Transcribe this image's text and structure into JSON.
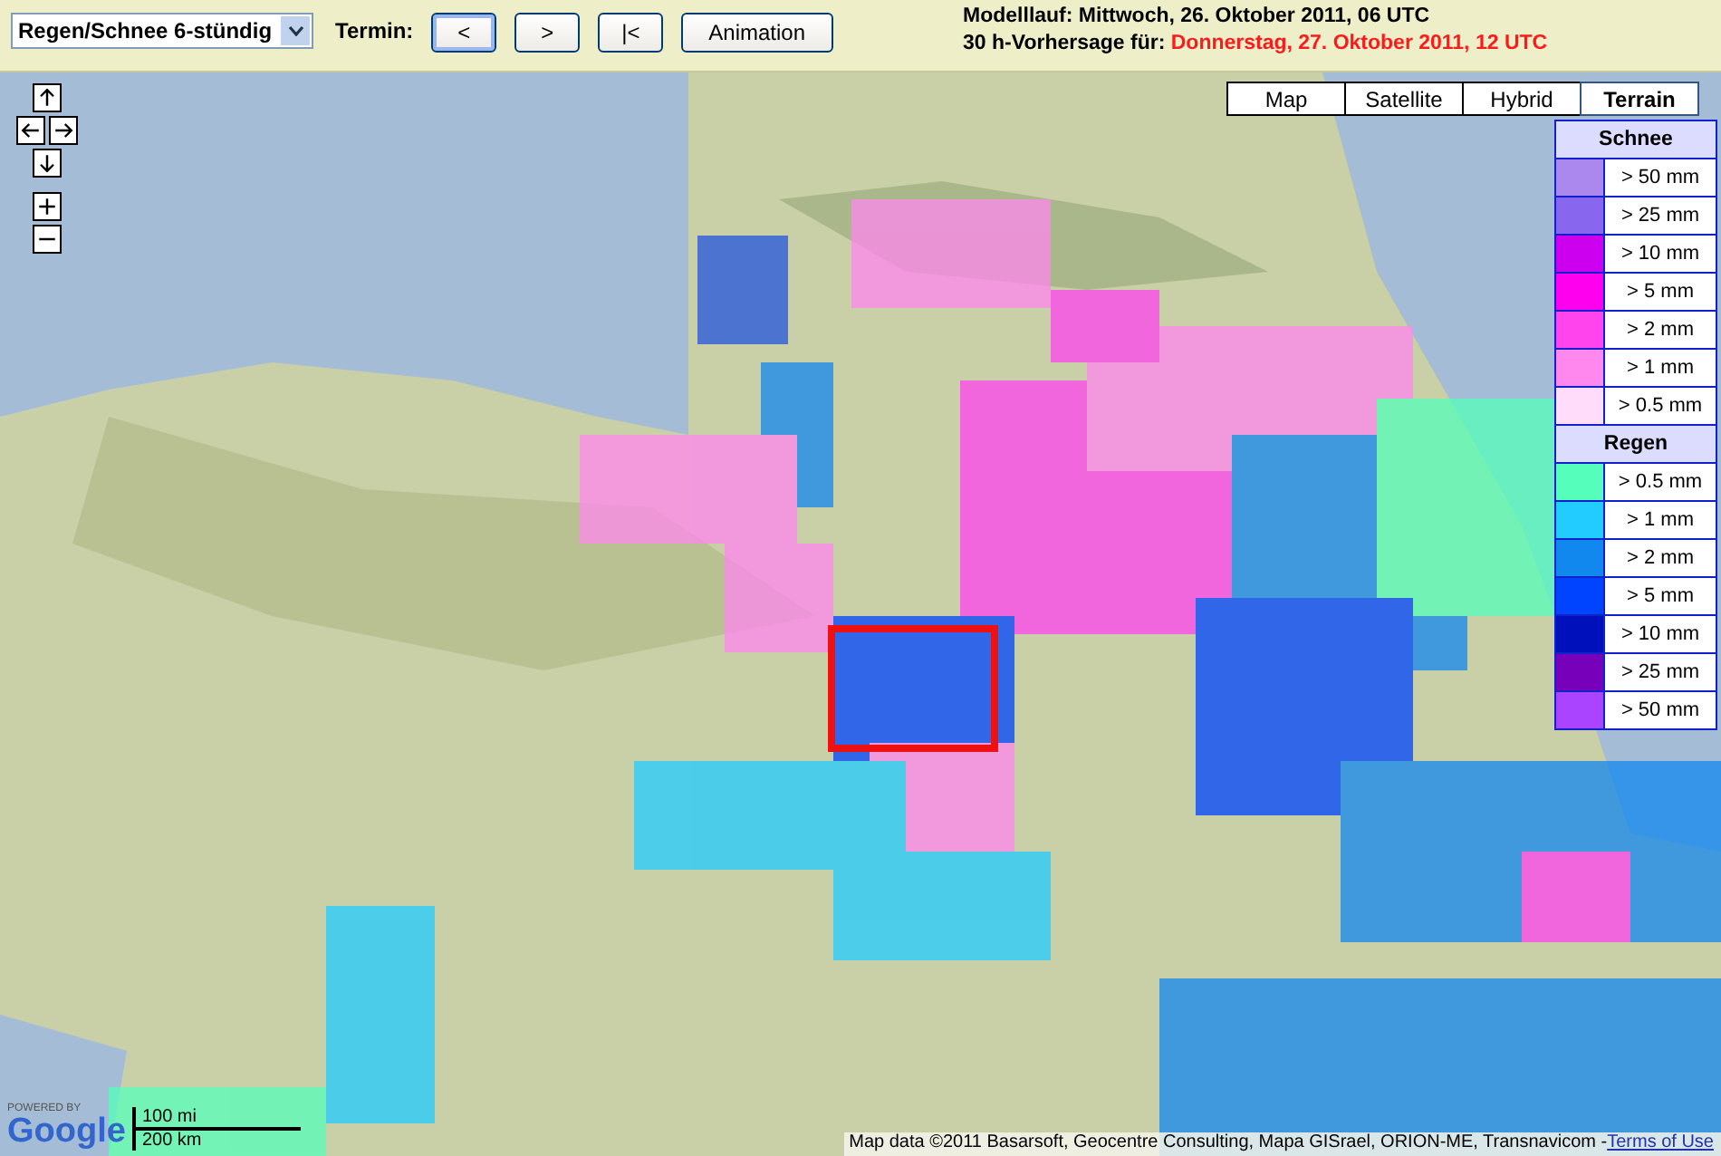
{
  "toolbar": {
    "product_select": {
      "value": "Regen/Schnee 6-stündig"
    },
    "termin_label": "Termin:",
    "buttons": [
      {
        "label": "<",
        "selected": true
      },
      {
        "label": ">",
        "selected": false
      },
      {
        "label": "|<",
        "selected": false
      },
      {
        "label": "Animation",
        "selected": false
      }
    ],
    "model_run": {
      "label": "Modelllauf:",
      "value": "Mittwoch, 26. Oktober 2011, 06 UTC"
    },
    "forecast": {
      "label": "30 h-Vorhersage für:",
      "value": "Donnerstag, 27. Oktober 2011, 12 UTC"
    }
  },
  "map": {
    "map_types": [
      {
        "label": "Map",
        "selected": false
      },
      {
        "label": "Satellite",
        "selected": false
      },
      {
        "label": "Hybrid",
        "selected": false
      },
      {
        "label": "Terrain",
        "selected": true
      }
    ],
    "nav_controls": [
      {
        "kind": "up"
      },
      {
        "kind": "left"
      },
      {
        "kind": "right"
      },
      {
        "kind": "down"
      },
      {
        "kind": "zoom-in"
      },
      {
        "kind": "zoom-out"
      }
    ],
    "legend": [
      {
        "title": "Schnee",
        "items": [
          {
            "label": "> 50 mm",
            "color": "#aa88ee"
          },
          {
            "label": "> 25 mm",
            "color": "#8866ee"
          },
          {
            "label": "> 10 mm",
            "color": "#cc00ee"
          },
          {
            "label": "> 5 mm",
            "color": "#ff00ee"
          },
          {
            "label": "> 2 mm",
            "color": "#ff44ee"
          },
          {
            "label": "> 1 mm",
            "color": "#ff88ee"
          },
          {
            "label": "> 0.5 mm",
            "color": "#ffddfa"
          }
        ]
      },
      {
        "title": "Regen",
        "items": [
          {
            "label": "> 0.5 mm",
            "color": "#55ffbb"
          },
          {
            "label": "> 1 mm",
            "color": "#22ccff"
          },
          {
            "label": "> 2 mm",
            "color": "#1188ee"
          },
          {
            "label": "> 5 mm",
            "color": "#0044ff"
          },
          {
            "label": "> 10 mm",
            "color": "#0011bb"
          },
          {
            "label": "> 25 mm",
            "color": "#7700bb"
          },
          {
            "label": "> 50 mm",
            "color": "#aa44ff"
          }
        ]
      }
    ],
    "logo": {
      "powered_by": "POWERED BY",
      "brand": "Google"
    },
    "scale": {
      "miles": "100 mi",
      "km": "200 km"
    },
    "attribution": {
      "text": "Map data ©2011 Basarsoft, Geocentre Consulting, Mapa GISrael, ORION-ME, Transnavicom -",
      "link": "Terms of Use"
    }
  }
}
